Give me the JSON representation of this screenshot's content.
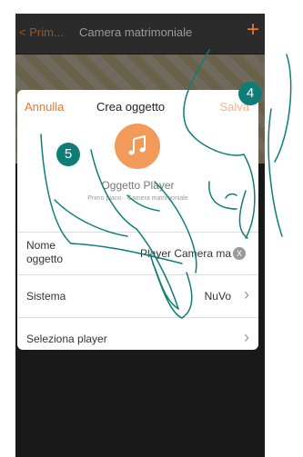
{
  "topbar": {
    "back_label": "< Prim...",
    "title": "Camera matrimoniale",
    "plus": "+"
  },
  "modal": {
    "cancel_label": "Annulla",
    "title": "Crea oggetto",
    "save_label": "Salva",
    "object_name": "Oggetto Player",
    "object_sub": "Primo piano · Camera matrimoniale"
  },
  "rows": [
    {
      "label": "Nome oggetto",
      "value": "Player Camera ma",
      "action": "X"
    },
    {
      "label": "Sistema",
      "value": "NuVo"
    },
    {
      "label": "Seleziona player",
      "value": ""
    }
  ],
  "badges": {
    "step4": "4",
    "step5": "5"
  },
  "colors": {
    "accent": "#e8782a",
    "badge": "#0e7d78"
  }
}
